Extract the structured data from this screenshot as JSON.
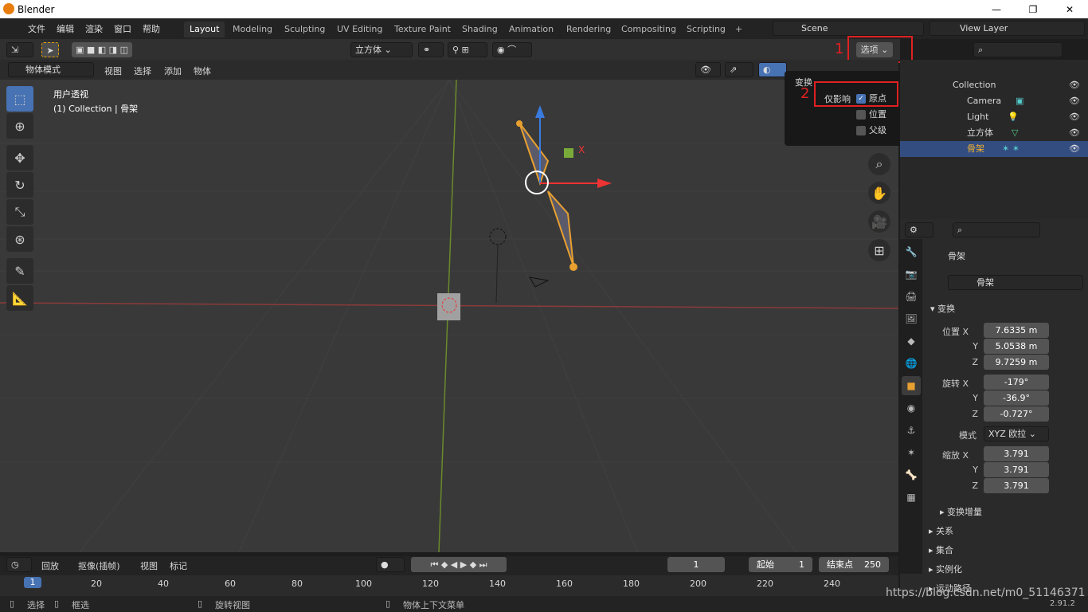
{
  "title": "Blender",
  "menus": [
    "文件",
    "编辑",
    "渲染",
    "窗口",
    "帮助"
  ],
  "workspaces": [
    "Layout",
    "Modeling",
    "Sculpting",
    "UV Editing",
    "Texture Paint",
    "Shading",
    "Animation",
    "Rendering",
    "Compositing",
    "Scripting"
  ],
  "scene": "Scene",
  "view_layer": "View Layer",
  "orientation": "立方体",
  "options_btn": "选项",
  "mode": "物体模式",
  "view_menus": [
    "视图",
    "选择",
    "添加",
    "物体"
  ],
  "viewport_label1": "用户透视",
  "viewport_label2": "(1) Collection | 骨架",
  "popover": {
    "title": "变换",
    "affect": "仅影响",
    "origin": "原点",
    "location": "位置",
    "parent": "父级"
  },
  "annotations": [
    "1",
    "2"
  ],
  "outliner": {
    "collection": "Collection",
    "items": [
      "Camera",
      "Light",
      "立方体",
      "骨架"
    ]
  },
  "props": {
    "obj_name": "骨架",
    "obj_data": "骨架",
    "transform": "变换",
    "loc_label": "位置",
    "rot_label": "旋转",
    "scale_label": "缩放",
    "mode_label": "模式",
    "mode_val": "XYZ 欧拉",
    "loc": [
      "7.6335 m",
      "5.0538 m",
      "9.7259 m"
    ],
    "rot": [
      "-179°",
      "-36.9°",
      "-0.727°"
    ],
    "scale": [
      "3.791",
      "3.791",
      "3.791"
    ],
    "sections": [
      "变换增量",
      "关系",
      "集合",
      "实例化",
      "运动路径"
    ]
  },
  "timeline": {
    "playback": "回放",
    "keying": "抠像(插帧)",
    "view": "视图",
    "marker": "标记",
    "frame": "1",
    "start_label": "起始",
    "start": "1",
    "end_label": "结束点",
    "end": "250",
    "ticks": [
      "20",
      "40",
      "60",
      "80",
      "100",
      "120",
      "140",
      "160",
      "180",
      "200",
      "220",
      "240"
    ]
  },
  "status": {
    "select": "选择",
    "box": "框选",
    "rotate": "旋转视图",
    "ctx": "物体上下文菜单",
    "url": "https://blog.csdn.net/m0_51146371",
    "version": "2.91.2"
  }
}
